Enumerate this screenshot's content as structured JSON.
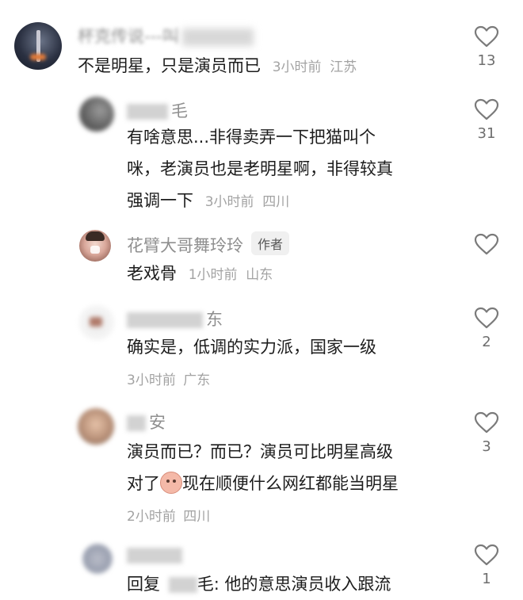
{
  "comments": [
    {
      "username": "杯克传说---叫",
      "text": "不是明星，只是演员而已",
      "time": "3小时前",
      "location": "江苏",
      "likes": "13"
    },
    {
      "username": "毛",
      "text_line1": "有啥意思...非得卖弄一下把猫叫个",
      "text_line2": "咪，老演员也是老明星啊，非得较真",
      "text_line3": "强调一下",
      "time": "3小时前",
      "location": "四川",
      "likes": "31"
    },
    {
      "username": "花臂大哥舞玲玲",
      "badge": "作者",
      "text": "老戏骨",
      "time": "1小时前",
      "location": "山东",
      "likes": ""
    },
    {
      "username": "东",
      "text": "确实是，低调的实力派，国家一级",
      "time": "3小时前",
      "location": "广东",
      "likes": "2"
    },
    {
      "username": "安",
      "text_line1": "演员而已？而已？演员可比明星高级",
      "text_line2_before": "对了",
      "text_line2_after": "现在顺便什么网红都能当明星",
      "time": "2小时前",
      "location": "四川",
      "likes": "3"
    },
    {
      "username": "",
      "reply_prefix": "回复",
      "reply_target": "毛",
      "text": ": 他的意思演员收入跟流",
      "likes": "1"
    }
  ],
  "icons": {
    "like": "heart-outline-icon",
    "emoji": "pig-face-emoji-icon"
  },
  "colors": {
    "text": "#1c1c1c",
    "secondary": "#a3a3a3",
    "heart": "#7a7a7a"
  }
}
